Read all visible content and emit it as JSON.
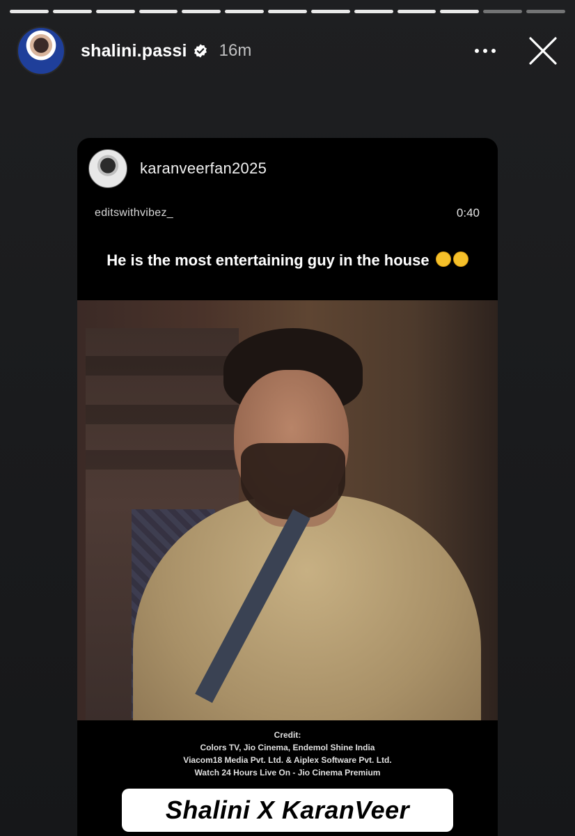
{
  "story": {
    "segments_total": 13,
    "segments_completed": 11
  },
  "header": {
    "username": "shalini.passi",
    "verified": true,
    "time": "16m",
    "more_icon": "more-horizontal-icon",
    "close_icon": "close-icon"
  },
  "repost": {
    "username": "karanveerfan2025",
    "original_account": "editswithvibez_",
    "duration": "0:40",
    "caption": "He is the most entertaining guy in the house",
    "emoji": "rolling-on-floor-laughing-emoji",
    "credits": [
      "Credit:",
      "Colors TV, Jio Cinema, Endemol Shine India",
      "Viacom18 Media Pvt. Ltd. & Aiplex Software Pvt. Ltd.",
      "Watch 24 Hours Live On - Jio Cinema Premium"
    ],
    "title": "Shalini X KaranVeer"
  },
  "colors": {
    "background": "#1c1d1f",
    "progress_done": "#e9e9e9",
    "verified_badge": "#ffffff",
    "title_box": "#ffffff"
  }
}
